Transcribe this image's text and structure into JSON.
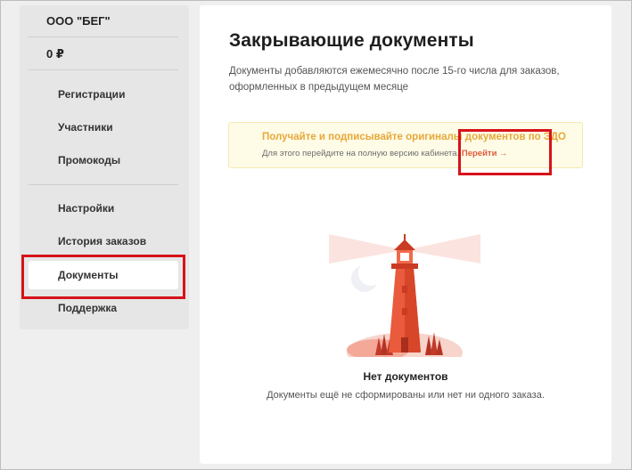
{
  "sidebar": {
    "company": "ООО \"БЕГ\"",
    "balance": "0 ₽",
    "items": [
      {
        "label": "Регистрации"
      },
      {
        "label": "Участники"
      },
      {
        "label": "Промокоды"
      },
      {
        "label": "Настройки"
      },
      {
        "label": "История заказов"
      },
      {
        "label": "Документы",
        "active": true
      },
      {
        "label": "Поддержка"
      }
    ]
  },
  "main": {
    "title": "Закрывающие документы",
    "description": "Документы добавляются ежемесячно после 15-го числа для заказов, оформленных в предыдущем месяце",
    "notice": {
      "title": "Получайте и подписывайте оригиналы документов по ЭДО",
      "text": "Для этого перейдите на полную версию кабинета.",
      "link_label": "Перейти →"
    },
    "empty_state": {
      "illustration_icon": "lighthouse-icon",
      "title": "Нет документов",
      "description": "Документы ещё не сформированы или нет ни одного заказа."
    }
  },
  "colors": {
    "accent": "#e05a3a",
    "notice_title": "#e7a83a",
    "notice_bg": "#fefbe6",
    "highlight": "#d6121a"
  }
}
